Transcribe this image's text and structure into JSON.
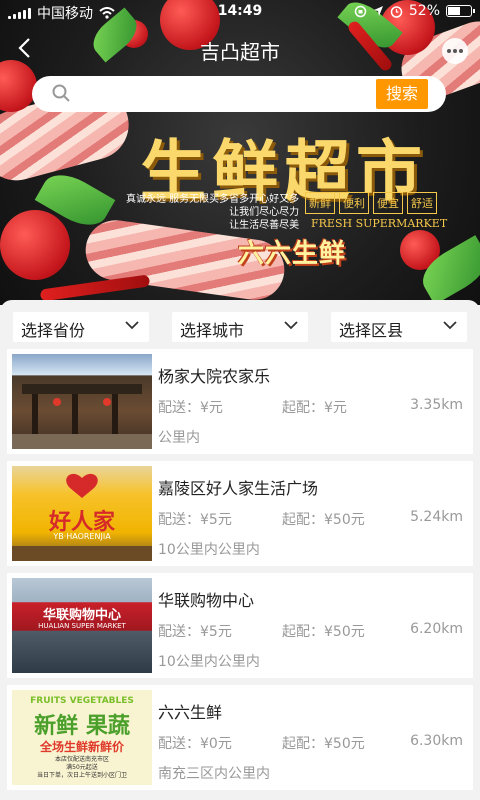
{
  "status": {
    "carrier": "中国移动",
    "time": "14:49",
    "battery": "52%"
  },
  "nav": {
    "title": "吉凸超市"
  },
  "search": {
    "placeholder": "",
    "button_label": "搜索"
  },
  "banner": {
    "title": "生鲜超市",
    "sub_line1": "真诚永远  服务无限买多省多开心好又多",
    "sub_line2": "让我们尽心尽力",
    "sub_line3": "让生活尽善尽美",
    "tags": [
      "新鲜",
      "便利",
      "便宜",
      "舒适"
    ],
    "english": "FRESH SUPERMARKET",
    "brand": "六六生鲜"
  },
  "filters": {
    "province": "选择省份",
    "city": "选择城市",
    "district": "选择区县"
  },
  "labels": {
    "delivery": "配送：",
    "minimum": "起配："
  },
  "stores": [
    {
      "name": "杨家大院农家乐",
      "delivery": "¥元",
      "minimum": "¥元",
      "distance": "3.35km",
      "range": "公里内"
    },
    {
      "name": "嘉陵区好人家生活广场",
      "delivery": "¥5元",
      "minimum": "¥50元",
      "distance": "5.24km",
      "range": "10公里内公里内",
      "thumb_text": "好人家",
      "thumb_sub": "YB·HAORENJIA"
    },
    {
      "name": "华联购物中心",
      "delivery": "¥5元",
      "minimum": "¥50元",
      "distance": "6.20km",
      "range": "10公里内公里内",
      "thumb_text": "华联购物中心",
      "thumb_sub": "HUALIAN SUPER MARKET"
    },
    {
      "name": "六六生鲜",
      "delivery": "¥0元",
      "minimum": "¥50元",
      "distance": "6.30km",
      "range": "南充三区内公里内",
      "thumb_text1": "FRUITS VEGETABLES",
      "thumb_text2": "新鲜 果蔬",
      "thumb_text3": "全场生鲜新鲜价",
      "thumb_text4": "本店仅配送南充市区",
      "thumb_text5": "满50元起送",
      "thumb_text6": "当日下单，次日上午送到小区门卫"
    }
  ],
  "colors": {
    "accent": "#ff9800",
    "text_muted": "#999999"
  }
}
